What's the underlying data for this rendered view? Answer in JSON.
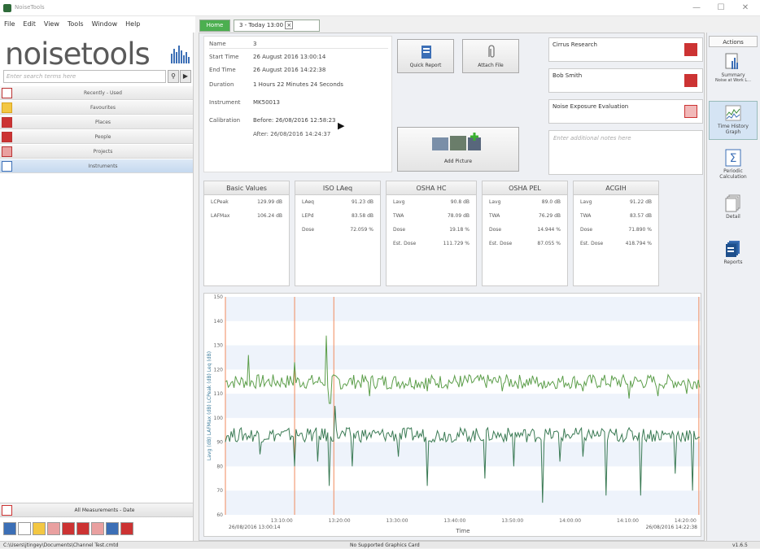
{
  "window": {
    "title": "NoiseTools",
    "minimize": "—",
    "maximize": "☐",
    "close": "✕"
  },
  "menu": [
    "File",
    "Edit",
    "View",
    "Tools",
    "Window",
    "Help"
  ],
  "left": {
    "logo": "noisetools",
    "search_placeholder": "Enter search terms here",
    "nav": [
      "Recently - Used",
      "Favourites",
      "Places",
      "People",
      "Projects",
      "Instruments"
    ],
    "all_measurements": "All Measurements - Date"
  },
  "tabs": {
    "home": "Home",
    "measurement": "3 - Today 13:00"
  },
  "info": {
    "rows": [
      {
        "k": "Name",
        "v": "3"
      },
      {
        "k": "Start Time",
        "v": "26 August 2016 13:00:14"
      },
      {
        "k": "End Time",
        "v": "26 August 2016 14:22:38"
      },
      {
        "k": "Duration",
        "v": "1 Hours 22 Minutes 24 Seconds"
      },
      {
        "k": "Instrument",
        "v": "MK50013"
      },
      {
        "k": "Calibration",
        "v": "Before: 26/08/2016 12:58:23"
      }
    ],
    "calibration_after": "After: 26/08/2016 14:24:37"
  },
  "buttons": {
    "quick_report": "Quick Report",
    "attach_file": "Attach File",
    "add_picture": "Add Picture"
  },
  "right_fields": [
    "Cirrus Research",
    "Bob Smith",
    "Noise Exposure Evaluation"
  ],
  "notes_placeholder": "Enter additional notes here",
  "value_boxes": [
    {
      "title": "Basic Values",
      "rows": [
        [
          "LCPeak",
          "129.99",
          "dB"
        ],
        [
          "LAFMax",
          "106.24",
          "dB"
        ]
      ]
    },
    {
      "title": "ISO LAeq",
      "rows": [
        [
          "LAeq",
          "91.23",
          "dB"
        ],
        [
          "LEPd",
          "83.58",
          "dB"
        ],
        [
          "Dose",
          "72.059",
          "%"
        ]
      ]
    },
    {
      "title": "OSHA HC",
      "rows": [
        [
          "Lavg",
          "90.8",
          "dB"
        ],
        [
          "TWA",
          "78.09",
          "dB"
        ],
        [
          "Dose",
          "19.18",
          "%"
        ],
        [
          "Est. Dose",
          "111.729",
          "%"
        ]
      ]
    },
    {
      "title": "OSHA PEL",
      "rows": [
        [
          "Lavg",
          "89.0",
          "dB"
        ],
        [
          "TWA",
          "76.29",
          "dB"
        ],
        [
          "Dose",
          "14.944",
          "%"
        ],
        [
          "Est. Dose",
          "87.055",
          "%"
        ]
      ]
    },
    {
      "title": "ACGIH",
      "rows": [
        [
          "Lavg",
          "91.22",
          "dB"
        ],
        [
          "TWA",
          "83.57",
          "dB"
        ],
        [
          "Dose",
          "71.890",
          "%"
        ],
        [
          "Est. Dose",
          "418.794",
          "%"
        ]
      ]
    }
  ],
  "actions": {
    "title": "Actions",
    "items": [
      {
        "label": "Summary",
        "sub": "Noise at Work L..."
      },
      {
        "label": "Time History",
        "sub": "Graph"
      },
      {
        "label": "Periodic",
        "sub": "Calculation"
      },
      {
        "label": "Detail",
        "sub": ""
      },
      {
        "label": "Reports",
        "sub": ""
      }
    ]
  },
  "status": {
    "path": "C:\\Users\\jtingey\\Documents\\Channel Test.cmtd",
    "center": "No Supported Graphics Card",
    "version": "v1.6.5"
  },
  "chart_data": {
    "type": "line",
    "xlabel": "Time",
    "ylabel": "Lavg (dB)  LAFMax (dB)  LCPeak (dB)  Leq (dB)",
    "ylim": [
      60,
      150
    ],
    "yticks": [
      60,
      70,
      80,
      90,
      100,
      110,
      120,
      130,
      140,
      150
    ],
    "xticks": [
      "13:10:00",
      "13:20:00",
      "13:30:00",
      "13:40:00",
      "13:50:00",
      "14:00:00",
      "14:10:00",
      "14:20:00"
    ],
    "start_label": "26/08/2016 13:00:14",
    "end_label": "26/08/2016 14:22:38",
    "markers_min": [
      0.0,
      12.0,
      18.8,
      82.1
    ],
    "duration_min": 82.4,
    "series": [
      {
        "color": "#5c9e4a",
        "base": 115,
        "spikes": [
          [
            4,
            126
          ],
          [
            12,
            123
          ],
          [
            17.5,
            134
          ],
          [
            18.2,
            106
          ],
          [
            20,
            112
          ],
          [
            25,
            109
          ],
          [
            28,
            112
          ],
          [
            35,
            111
          ],
          [
            41,
            113
          ],
          [
            48,
            111
          ],
          [
            55,
            112
          ],
          [
            62,
            111
          ],
          [
            70,
            108
          ],
          [
            75,
            109
          ],
          [
            80,
            110
          ]
        ]
      },
      {
        "color": "#3a7a54",
        "base": 93,
        "spikes": [
          [
            6,
            85
          ],
          [
            12,
            80
          ],
          [
            16,
            82
          ],
          [
            18,
            72
          ],
          [
            19,
            105
          ],
          [
            22,
            80
          ],
          [
            30,
            84
          ],
          [
            35,
            72
          ],
          [
            45,
            75
          ],
          [
            50,
            80
          ],
          [
            55,
            65
          ],
          [
            58,
            82
          ],
          [
            62,
            84
          ],
          [
            66,
            68
          ],
          [
            72,
            68
          ],
          [
            78,
            77
          ],
          [
            81,
            70
          ]
        ]
      }
    ]
  }
}
